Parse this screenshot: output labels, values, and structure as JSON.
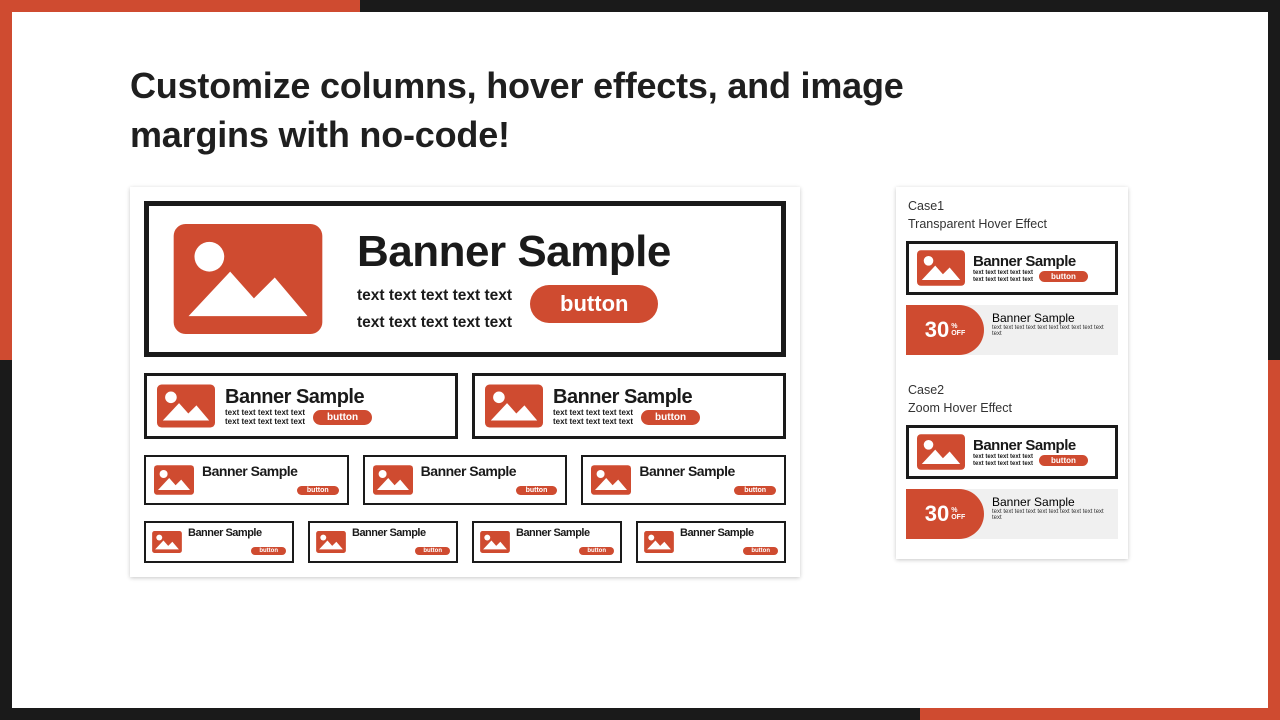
{
  "colors": {
    "accent": "#cf4b30",
    "dark": "#1a1a1a",
    "bg": "#ffffff"
  },
  "heading": "Customize columns, hover effects, and image margins with no-code!",
  "banner": {
    "title": "Banner Sample",
    "subtext": "text text text text text text text text text text",
    "subtext_line1": "text text text text text",
    "subtext_line2": "text text text text text",
    "button_label": "button"
  },
  "promo": {
    "value": "30",
    "percent": "%",
    "off": "OFF",
    "title": "Banner Sample",
    "sub": "text text text text text text text text text text text"
  },
  "cases": {
    "c1_label": "Case1",
    "c1_desc": "Transparent Hover Effect",
    "c2_label": "Case2",
    "c2_desc": "Zoom Hover Effect"
  }
}
